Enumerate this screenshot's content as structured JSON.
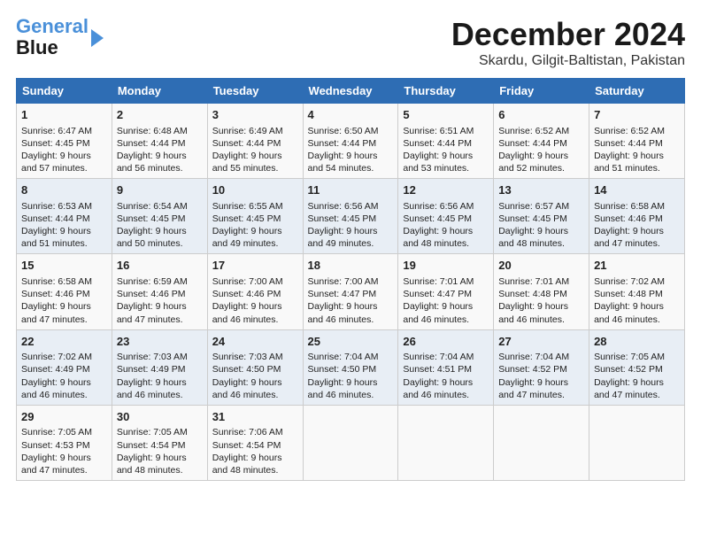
{
  "logo": {
    "line1": "General",
    "line2": "Blue"
  },
  "title": "December 2024",
  "location": "Skardu, Gilgit-Baltistan, Pakistan",
  "headers": [
    "Sunday",
    "Monday",
    "Tuesday",
    "Wednesday",
    "Thursday",
    "Friday",
    "Saturday"
  ],
  "weeks": [
    [
      {
        "day": "1",
        "info": "Sunrise: 6:47 AM\nSunset: 4:45 PM\nDaylight: 9 hours\nand 57 minutes."
      },
      {
        "day": "2",
        "info": "Sunrise: 6:48 AM\nSunset: 4:44 PM\nDaylight: 9 hours\nand 56 minutes."
      },
      {
        "day": "3",
        "info": "Sunrise: 6:49 AM\nSunset: 4:44 PM\nDaylight: 9 hours\nand 55 minutes."
      },
      {
        "day": "4",
        "info": "Sunrise: 6:50 AM\nSunset: 4:44 PM\nDaylight: 9 hours\nand 54 minutes."
      },
      {
        "day": "5",
        "info": "Sunrise: 6:51 AM\nSunset: 4:44 PM\nDaylight: 9 hours\nand 53 minutes."
      },
      {
        "day": "6",
        "info": "Sunrise: 6:52 AM\nSunset: 4:44 PM\nDaylight: 9 hours\nand 52 minutes."
      },
      {
        "day": "7",
        "info": "Sunrise: 6:52 AM\nSunset: 4:44 PM\nDaylight: 9 hours\nand 51 minutes."
      }
    ],
    [
      {
        "day": "8",
        "info": "Sunrise: 6:53 AM\nSunset: 4:44 PM\nDaylight: 9 hours\nand 51 minutes."
      },
      {
        "day": "9",
        "info": "Sunrise: 6:54 AM\nSunset: 4:45 PM\nDaylight: 9 hours\nand 50 minutes."
      },
      {
        "day": "10",
        "info": "Sunrise: 6:55 AM\nSunset: 4:45 PM\nDaylight: 9 hours\nand 49 minutes."
      },
      {
        "day": "11",
        "info": "Sunrise: 6:56 AM\nSunset: 4:45 PM\nDaylight: 9 hours\nand 49 minutes."
      },
      {
        "day": "12",
        "info": "Sunrise: 6:56 AM\nSunset: 4:45 PM\nDaylight: 9 hours\nand 48 minutes."
      },
      {
        "day": "13",
        "info": "Sunrise: 6:57 AM\nSunset: 4:45 PM\nDaylight: 9 hours\nand 48 minutes."
      },
      {
        "day": "14",
        "info": "Sunrise: 6:58 AM\nSunset: 4:46 PM\nDaylight: 9 hours\nand 47 minutes."
      }
    ],
    [
      {
        "day": "15",
        "info": "Sunrise: 6:58 AM\nSunset: 4:46 PM\nDaylight: 9 hours\nand 47 minutes."
      },
      {
        "day": "16",
        "info": "Sunrise: 6:59 AM\nSunset: 4:46 PM\nDaylight: 9 hours\nand 47 minutes."
      },
      {
        "day": "17",
        "info": "Sunrise: 7:00 AM\nSunset: 4:46 PM\nDaylight: 9 hours\nand 46 minutes."
      },
      {
        "day": "18",
        "info": "Sunrise: 7:00 AM\nSunset: 4:47 PM\nDaylight: 9 hours\nand 46 minutes."
      },
      {
        "day": "19",
        "info": "Sunrise: 7:01 AM\nSunset: 4:47 PM\nDaylight: 9 hours\nand 46 minutes."
      },
      {
        "day": "20",
        "info": "Sunrise: 7:01 AM\nSunset: 4:48 PM\nDaylight: 9 hours\nand 46 minutes."
      },
      {
        "day": "21",
        "info": "Sunrise: 7:02 AM\nSunset: 4:48 PM\nDaylight: 9 hours\nand 46 minutes."
      }
    ],
    [
      {
        "day": "22",
        "info": "Sunrise: 7:02 AM\nSunset: 4:49 PM\nDaylight: 9 hours\nand 46 minutes."
      },
      {
        "day": "23",
        "info": "Sunrise: 7:03 AM\nSunset: 4:49 PM\nDaylight: 9 hours\nand 46 minutes."
      },
      {
        "day": "24",
        "info": "Sunrise: 7:03 AM\nSunset: 4:50 PM\nDaylight: 9 hours\nand 46 minutes."
      },
      {
        "day": "25",
        "info": "Sunrise: 7:04 AM\nSunset: 4:50 PM\nDaylight: 9 hours\nand 46 minutes."
      },
      {
        "day": "26",
        "info": "Sunrise: 7:04 AM\nSunset: 4:51 PM\nDaylight: 9 hours\nand 46 minutes."
      },
      {
        "day": "27",
        "info": "Sunrise: 7:04 AM\nSunset: 4:52 PM\nDaylight: 9 hours\nand 47 minutes."
      },
      {
        "day": "28",
        "info": "Sunrise: 7:05 AM\nSunset: 4:52 PM\nDaylight: 9 hours\nand 47 minutes."
      }
    ],
    [
      {
        "day": "29",
        "info": "Sunrise: 7:05 AM\nSunset: 4:53 PM\nDaylight: 9 hours\nand 47 minutes."
      },
      {
        "day": "30",
        "info": "Sunrise: 7:05 AM\nSunset: 4:54 PM\nDaylight: 9 hours\nand 48 minutes."
      },
      {
        "day": "31",
        "info": "Sunrise: 7:06 AM\nSunset: 4:54 PM\nDaylight: 9 hours\nand 48 minutes."
      },
      {
        "day": "",
        "info": ""
      },
      {
        "day": "",
        "info": ""
      },
      {
        "day": "",
        "info": ""
      },
      {
        "day": "",
        "info": ""
      }
    ]
  ]
}
